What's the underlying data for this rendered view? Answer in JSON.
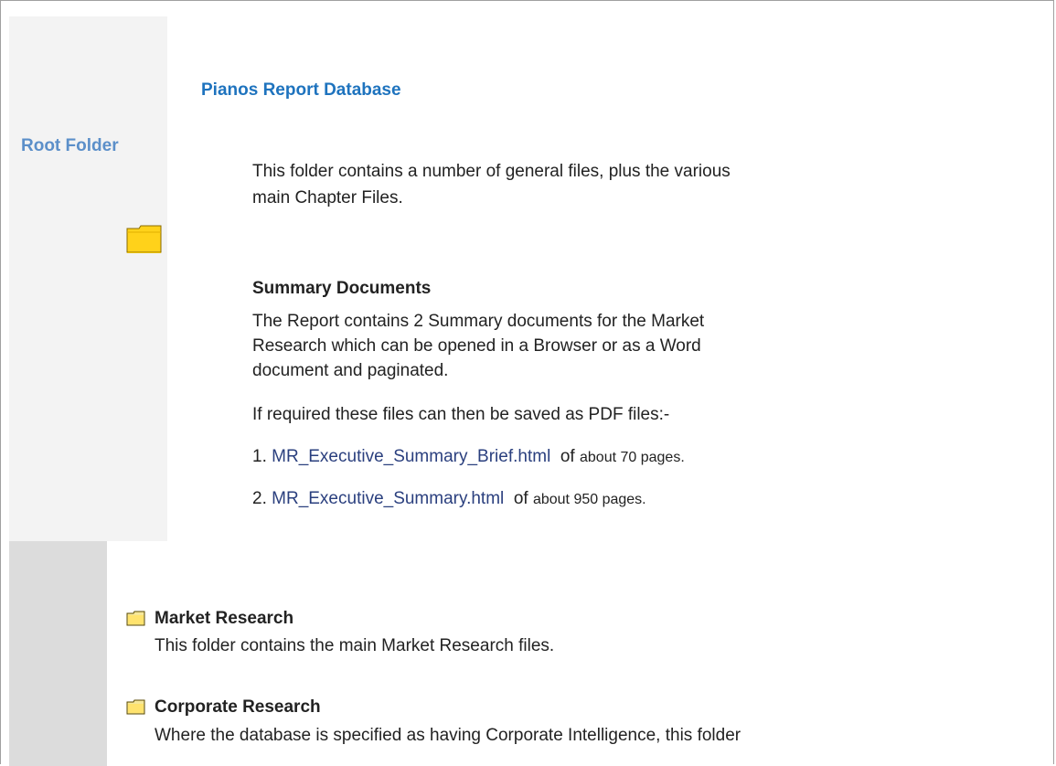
{
  "sidebar": {
    "label": "Root Folder"
  },
  "header": {
    "title": "Pianos Report Database"
  },
  "intro": {
    "line1": "This folder contains a number of general files, plus the various",
    "line2": "main Chapter Files."
  },
  "summary": {
    "heading": "Summary Documents",
    "para_line1": "The Report contains 2 Summary documents for the Market",
    "para_line2": "Research which can be opened in a Browser or as a Word",
    "para_line3": "document and paginated.",
    "pdf_note": "If required these files can then be saved as PDF files:-",
    "items": [
      {
        "num": "1.",
        "link": "MR_Executive_Summary_Brief.html",
        "of": "of",
        "desc": "about 70 pages."
      },
      {
        "num": "2.",
        "link": "MR_Executive_Summary.html",
        "of": "of",
        "desc": "about 950 pages."
      }
    ]
  },
  "folders": [
    {
      "title": "Market Research",
      "desc": "This folder contains the main Market Research files."
    },
    {
      "title": "Corporate Research",
      "desc": "Where the database is specified as having Corporate Intelligence, this folder"
    }
  ],
  "icons": {
    "root_folder": "folder-icon",
    "market_folder": "folder-icon",
    "corporate_folder": "folder-icon"
  },
  "colors": {
    "title": "#1e73be",
    "root_label": "#5b8fc9",
    "link": "#2a3f7e",
    "folder_fill": "#ffd21a"
  }
}
